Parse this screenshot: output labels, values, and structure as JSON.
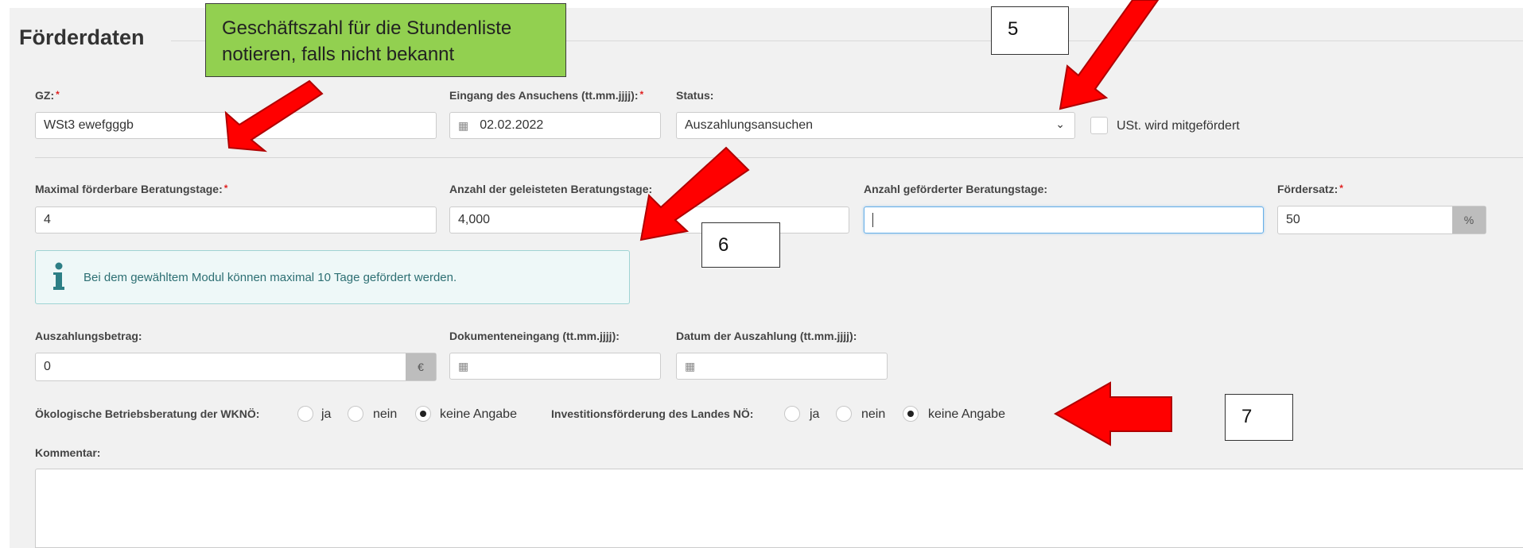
{
  "section": {
    "title": "Förderdaten"
  },
  "annotations": {
    "green_note": {
      "line1": "Geschäftszahl für die Stundenliste",
      "line2": "notieren, falls nicht bekannt"
    },
    "marker_5": "5",
    "marker_6": "6",
    "marker_7": "7",
    "arrow_color": "#ff0000",
    "note_color": "#92d050"
  },
  "fields": {
    "gz": {
      "label": "GZ:",
      "value": "WSt3 ewefgggb"
    },
    "eingang": {
      "label": "Eingang des Ansuchens (tt.mm.jjjj):",
      "value": "02.02.2022"
    },
    "status": {
      "label": "Status:",
      "value": "Auszahlungsansuchen"
    },
    "ust": {
      "label": "USt. wird mitgefördert",
      "checked": false
    },
    "max_tage": {
      "label": "Maximal förderbare Beratungstage:",
      "value": "4"
    },
    "geleistete_tage": {
      "label": "Anzahl der geleisteten Beratungstage:",
      "value": "4,000"
    },
    "gefoerderte_tage": {
      "label": "Anzahl geförderter Beratungstage:",
      "value": ""
    },
    "foerdersatz": {
      "label": "Fördersatz:",
      "value": "50",
      "unit": "%"
    },
    "auszahlungsbetrag": {
      "label": "Auszahlungsbetrag:",
      "value": "0",
      "unit": "€"
    },
    "dokumenteneingang": {
      "label": "Dokumenteneingang (tt.mm.jjjj):",
      "value": ""
    },
    "datum_auszahlung": {
      "label": "Datum der Auszahlung (tt.mm.jjjj):",
      "value": ""
    },
    "kommentar": {
      "label": "Kommentar:",
      "value": ""
    }
  },
  "info": {
    "text": "Bei dem gewähltem Modul können maximal 10 Tage gefördert werden."
  },
  "radios": {
    "oeko": {
      "label": "Ökologische Betriebsberatung der WKNÖ:",
      "options": [
        "ja",
        "nein",
        "keine Angabe"
      ],
      "selected": "keine Angabe"
    },
    "invest": {
      "label": "Investitionsförderung des Landes NÖ:",
      "options": [
        "ja",
        "nein",
        "keine Angabe"
      ],
      "selected": "keine Angabe"
    }
  }
}
